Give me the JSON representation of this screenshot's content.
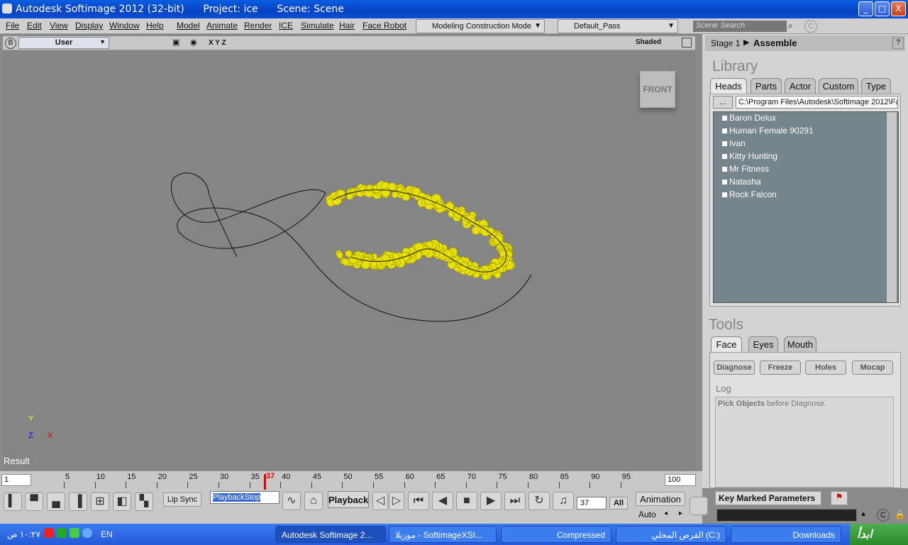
{
  "window": {
    "title": "Autodesk Softimage 2012 (32-bit)",
    "project": "Project: ice",
    "scene": "Scene: Scene",
    "min": "_",
    "max": "□",
    "close": "X"
  },
  "menu": {
    "items": [
      "File",
      "Edit",
      "View",
      "Display",
      "Window",
      "Help",
      "Model",
      "Animate",
      "Render",
      "ICE",
      "Simulate",
      "Hair",
      "Face Robot"
    ],
    "mode": "Modeling Construction Mode",
    "pass": "Default_Pass",
    "search_placeholder": "Scene Search"
  },
  "viewport": {
    "camera_badge": "B",
    "camera": "User",
    "axes": "X Y Z",
    "shading": "Shaded",
    "cube_label": "FRONT",
    "result_label": "Result",
    "axis_y": "Y",
    "axis_x": "X",
    "axis_z": "Z"
  },
  "right_panel": {
    "stage": "Stage 1",
    "stage_name": "Assemble",
    "help": "?",
    "library_title": "Library",
    "library_tabs": [
      "Heads",
      "Parts",
      "Actor",
      "Custom",
      "Type"
    ],
    "browse": "...",
    "path": "C:\\Program Files\\Autodesk\\Softimage 2012\\Fa",
    "heads": [
      "Baron Delux",
      "Human Female 90291",
      "Ivan",
      "Kitty Hunting",
      "Mr Fitness",
      "Natasha",
      "Rock Falcon"
    ],
    "tools_title": "Tools",
    "tools_tabs": [
      "Face",
      "Eyes",
      "Mouth"
    ],
    "tool_buttons": [
      "Diagnose",
      "Freeze",
      "Holes",
      "Mocap"
    ],
    "log_title": "Log",
    "log_bold": "Pick Objects",
    "log_rest": " before Diagnose."
  },
  "timeline": {
    "start": "1",
    "end": "100",
    "current": "37",
    "ticks": [
      "5",
      "10",
      "15",
      "20",
      "25",
      "30",
      "35",
      "40",
      "45",
      "50",
      "55",
      "60",
      "65",
      "70",
      "75",
      "80",
      "85",
      "90",
      "95"
    ]
  },
  "bottom": {
    "lip_sync": "Lip Sync",
    "playback_stop": "PlaybackStop",
    "playback": "Playback",
    "frame": "37",
    "all": "All",
    "animation": "Animation",
    "auto": "Auto",
    "key_marked": "Key Marked Parameters"
  },
  "taskbar": {
    "clock": "١٠:٢٧ ص",
    "lang": "EN",
    "tasks": [
      "Autodesk Softimage 2...",
      "موزيلا - SoftimageXSI...",
      "Compressed",
      "القرص المحلي (C:)",
      "Downloads"
    ],
    "start": "ابدأ"
  }
}
